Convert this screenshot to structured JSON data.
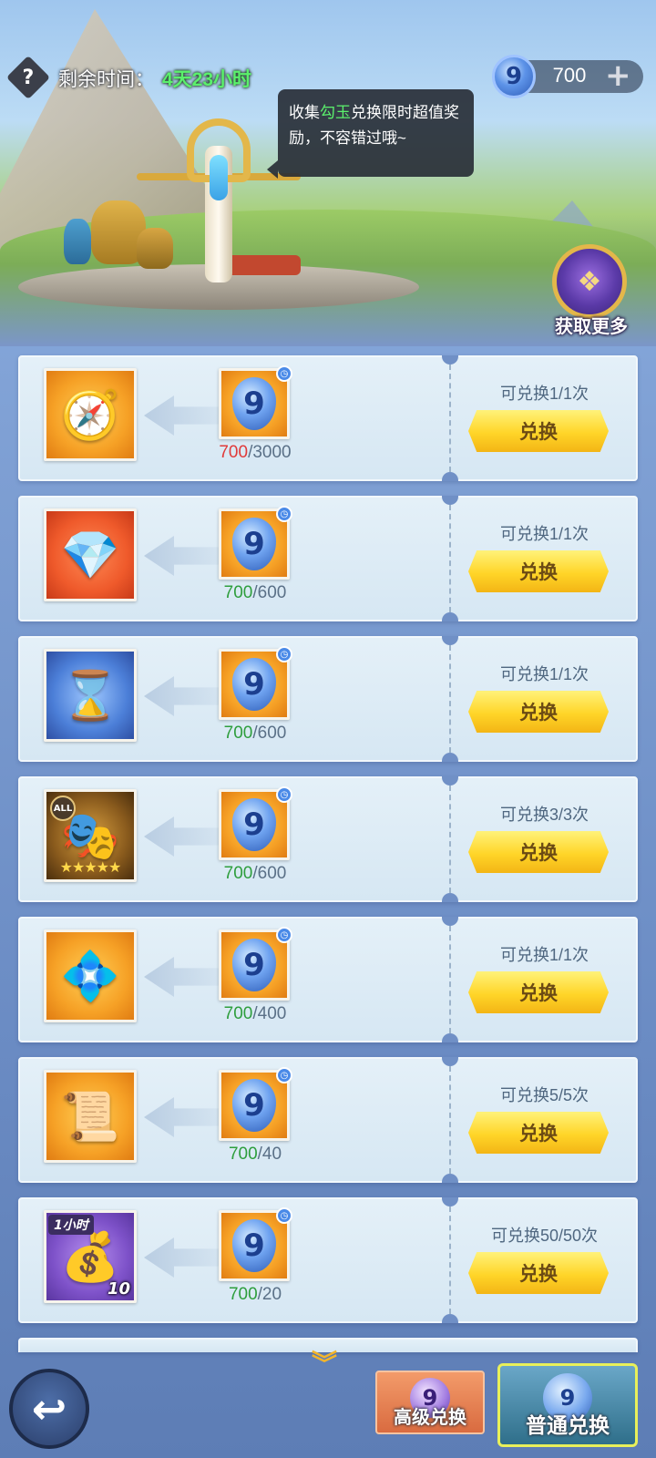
{
  "header": {
    "help_icon": "question-icon",
    "time_label": "剩余时间：",
    "time_value": "4天23小时",
    "currency": {
      "icon": "magatama-icon",
      "value": "700",
      "plus": "+"
    },
    "tooltip": {
      "prefix": "收集",
      "highlight": "勾玉",
      "suffix": "兑换限时超值奖励，不容错过哦~"
    },
    "more": {
      "label": "获取更多",
      "icon": "lotus-emblem-icon"
    }
  },
  "colors": {
    "accent_green": "#5bf06c",
    "insufficient_red": "#e03a3a",
    "sufficient_green": "#2e9e3d",
    "button_yellow": "#ffd528"
  },
  "items": [
    {
      "reward_icon": "golden-compass-amulet-icon",
      "glyph": "🧭",
      "bg": "orange",
      "have": "700",
      "cost": "3000",
      "insufficient": true,
      "limit": "可兑换1/1次",
      "button": "兑换"
    },
    {
      "reward_icon": "blue-crystal-icon",
      "glyph": "💎",
      "bg": "red",
      "have": "700",
      "cost": "600",
      "insufficient": false,
      "limit": "可兑换1/1次",
      "button": "兑换"
    },
    {
      "reward_icon": "hourglass-icon",
      "glyph": "⌛",
      "bg": "blue",
      "have": "700",
      "cost": "600",
      "insufficient": false,
      "limit": "可兑换1/1次",
      "button": "兑换"
    },
    {
      "reward_icon": "golden-mask-icon",
      "glyph": "🎭",
      "bg": "gold",
      "tag": "ALL",
      "stars": "★★★★★",
      "have": "700",
      "cost": "600",
      "insufficient": false,
      "limit": "可兑换3/3次",
      "button": "兑换"
    },
    {
      "reward_icon": "winged-gem-icon",
      "glyph": "💠",
      "bg": "orange",
      "have": "700",
      "cost": "400",
      "insufficient": false,
      "limit": "可兑换1/1次",
      "button": "兑换"
    },
    {
      "reward_icon": "scroll-icon",
      "glyph": "📜",
      "bg": "orange",
      "have": "700",
      "cost": "40",
      "insufficient": false,
      "limit": "可兑换5/5次",
      "button": "兑换"
    },
    {
      "reward_icon": "gold-pouch-icon",
      "glyph": "💰",
      "bg": "purple",
      "time_tag": "1小时",
      "count": "10",
      "have": "700",
      "cost": "20",
      "insufficient": false,
      "limit": "可兑换50/50次",
      "button": "兑换"
    }
  ],
  "footer": {
    "scroll_hint_icon": "chevron-down-icon",
    "back_icon": "back-arrow-icon",
    "tabs": [
      {
        "label": "高级兑换",
        "icon": "purple-magatama-icon"
      },
      {
        "label": "普通兑换",
        "icon": "blue-magatama-icon",
        "selected": true
      }
    ]
  }
}
